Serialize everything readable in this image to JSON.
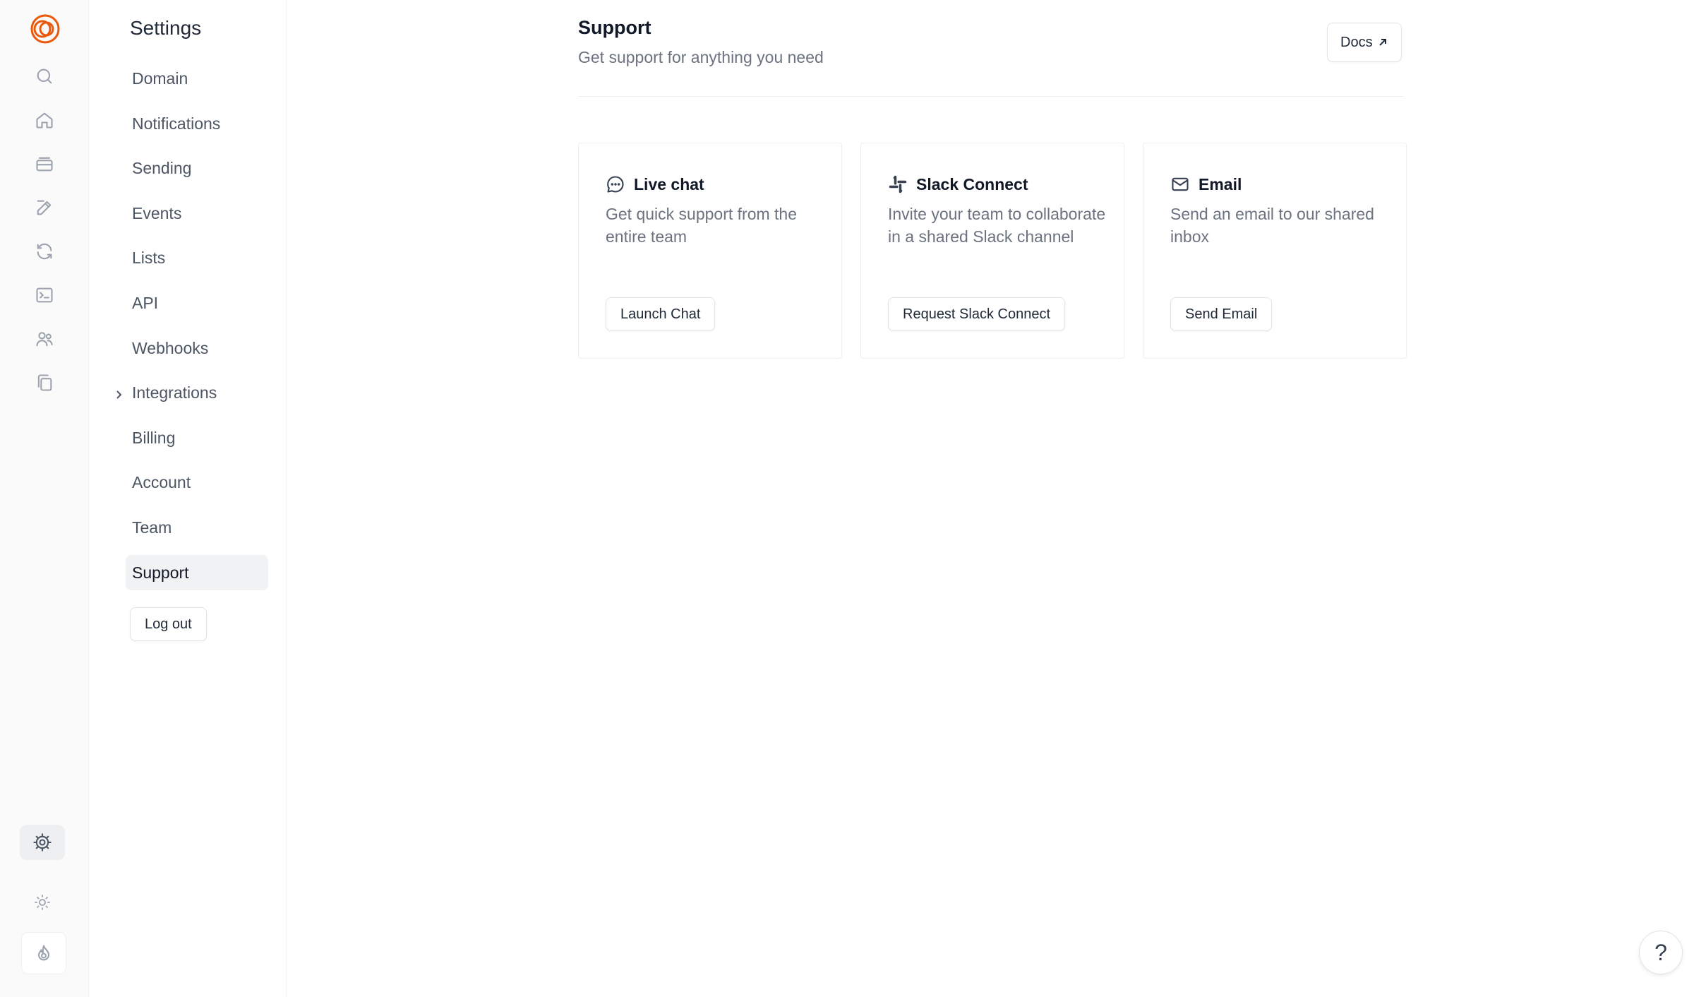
{
  "brand": {
    "accent": "#ea580c",
    "logo_icon": "loops-logo-icon"
  },
  "rail": {
    "items": [
      {
        "icon": "search-icon"
      },
      {
        "icon": "home-icon"
      },
      {
        "icon": "inbox-icon"
      },
      {
        "icon": "edit-icon"
      },
      {
        "icon": "refresh-icon"
      },
      {
        "icon": "terminal-icon"
      },
      {
        "icon": "users-icon"
      },
      {
        "icon": "copy-icon"
      }
    ],
    "bottom": [
      {
        "icon": "gear-icon",
        "active": true
      },
      {
        "icon": "sun-icon"
      },
      {
        "icon": "flame-icon"
      }
    ]
  },
  "sidebar": {
    "title": "Settings",
    "items": [
      {
        "label": "Domain"
      },
      {
        "label": "Notifications"
      },
      {
        "label": "Sending"
      },
      {
        "label": "Events"
      },
      {
        "label": "Lists"
      },
      {
        "label": "API"
      },
      {
        "label": "Webhooks"
      },
      {
        "label": "Integrations",
        "expandable": true
      },
      {
        "label": "Billing"
      },
      {
        "label": "Account"
      },
      {
        "label": "Team"
      },
      {
        "label": "Support",
        "active": true
      }
    ],
    "logout_label": "Log out"
  },
  "main": {
    "title": "Support",
    "subtitle": "Get support for anything you need",
    "docs_label": "Docs",
    "cards": [
      {
        "icon": "chat-bubble-icon",
        "title": "Live chat",
        "description": "Get quick support from the entire team",
        "button": "Launch Chat"
      },
      {
        "icon": "slack-icon",
        "title": "Slack Connect",
        "description": "Invite your team to collaborate in a shared Slack channel",
        "button": "Request Slack Connect"
      },
      {
        "icon": "mail-icon",
        "title": "Email",
        "description": "Send an email to our shared inbox",
        "button": "Send Email"
      }
    ]
  },
  "help": {
    "label": "?"
  }
}
